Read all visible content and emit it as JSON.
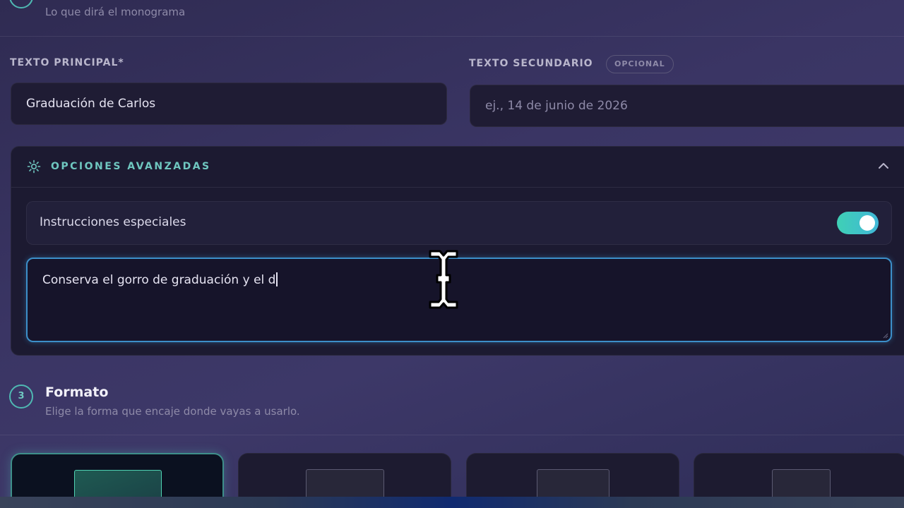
{
  "step_top": {
    "subtitle": "Lo que dirá el monograma"
  },
  "main_text": {
    "label": "TEXTO PRINCIPAL*",
    "value": "Graduación de Carlos"
  },
  "secondary_text": {
    "label": "TEXTO SECUNDARIO",
    "badge": "OPCIONAL",
    "placeholder": "ej., 14 de junio de 2026"
  },
  "advanced": {
    "title": "OPCIONES AVANZADAS",
    "special_label": "Instrucciones especiales",
    "special_toggle_on": true,
    "textarea_value": "Conserva el gorro de graduación y el d"
  },
  "step3": {
    "number": "3",
    "title": "Formato",
    "subtitle": "Elige la forma que encaje donde vayas a usarlo."
  },
  "format_options": [
    {
      "selected": true
    },
    {
      "selected": false
    },
    {
      "selected": false
    },
    {
      "selected": false
    }
  ],
  "colors": {
    "accent": "#4fb8b2",
    "toggle_on": "#3fd0b5",
    "focus_border": "#3c8fc9"
  },
  "icons": [
    "gear-icon",
    "chevron-up-icon",
    "text-cursor-icon",
    "resize-handle-icon"
  ]
}
